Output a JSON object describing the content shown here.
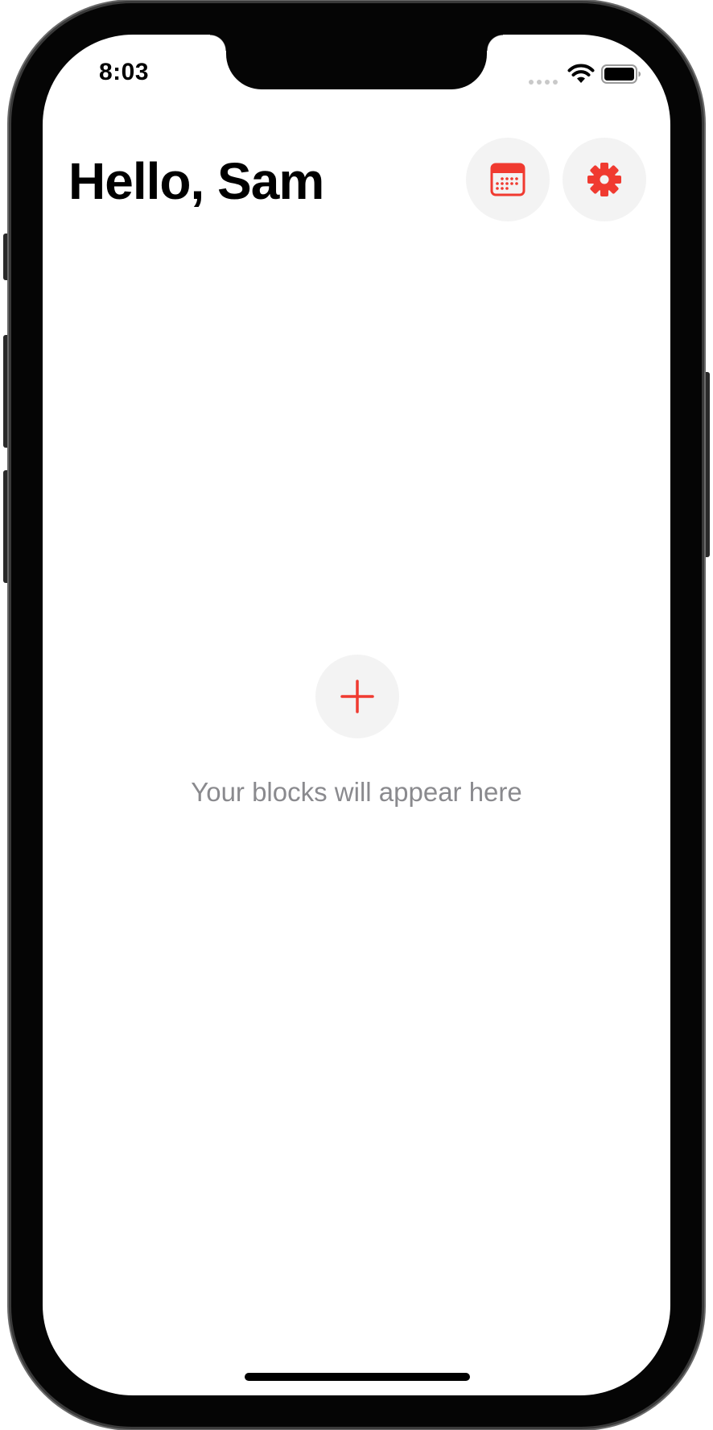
{
  "status_bar": {
    "time": "8:03",
    "icons": [
      "signal-dots-icon",
      "wifi-icon",
      "battery-icon"
    ]
  },
  "header": {
    "greeting": "Hello, Sam",
    "buttons": [
      {
        "name": "calendar-button",
        "icon": "calendar-icon"
      },
      {
        "name": "settings-button",
        "icon": "gear-icon"
      }
    ]
  },
  "main": {
    "add_button_icon": "plus-icon",
    "empty_text": "Your blocks will appear here"
  },
  "colors": {
    "accent": "#f03a30",
    "button_bg": "#f3f3f3",
    "secondary_text": "#8a8a8e",
    "background": "#ffffff"
  }
}
